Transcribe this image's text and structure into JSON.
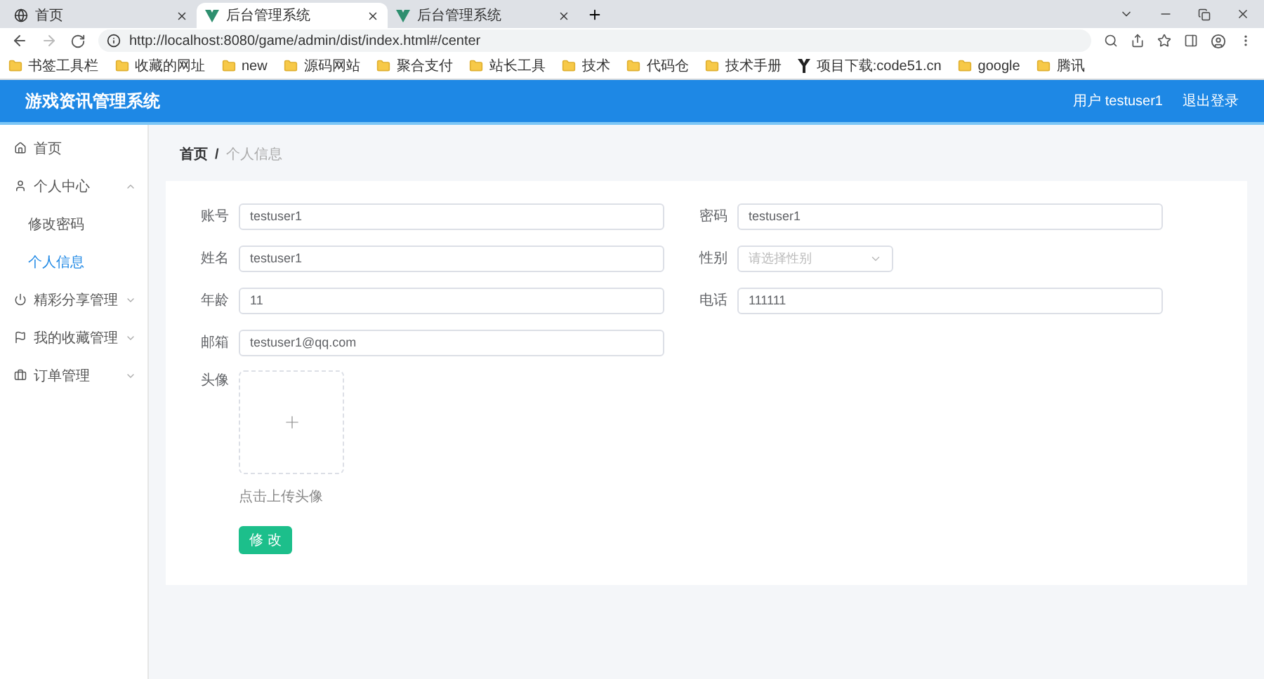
{
  "browser": {
    "tabs": [
      {
        "title": "首页",
        "kind": "globe",
        "selected": false
      },
      {
        "title": "后台管理系统",
        "kind": "vue",
        "selected": true
      },
      {
        "title": "后台管理系统",
        "kind": "vue",
        "selected": false
      }
    ],
    "address": "http://localhost:8080/game/admin/dist/index.html#/center",
    "bookmarks": [
      {
        "label": "书签工具栏",
        "kind": "folder"
      },
      {
        "label": "收藏的网址",
        "kind": "folder"
      },
      {
        "label": "new",
        "kind": "folder"
      },
      {
        "label": "源码网站",
        "kind": "folder"
      },
      {
        "label": "聚合支付",
        "kind": "folder"
      },
      {
        "label": "站长工具",
        "kind": "folder"
      },
      {
        "label": "技术",
        "kind": "folder"
      },
      {
        "label": "代码仓",
        "kind": "folder"
      },
      {
        "label": "技术手册",
        "kind": "folder"
      },
      {
        "label": "项目下载:code51.cn",
        "kind": "logo"
      },
      {
        "label": "google",
        "kind": "folder"
      },
      {
        "label": "腾讯",
        "kind": "folder"
      }
    ]
  },
  "header": {
    "title": "游戏资讯管理系统",
    "user": "用户 testuser1",
    "logout": "退出登录"
  },
  "sidebar": {
    "items": [
      {
        "label": "首页",
        "kind": "home",
        "selected": false
      },
      {
        "label": "个人中心",
        "kind": "user",
        "expanded": true,
        "selected": false,
        "children": [
          {
            "label": "修改密码",
            "selected": false
          },
          {
            "label": "个人信息",
            "selected": true
          }
        ]
      },
      {
        "label": "精彩分享管理",
        "kind": "power",
        "expanded": false,
        "selected": false
      },
      {
        "label": "我的收藏管理",
        "kind": "flag",
        "expanded": false,
        "selected": false
      },
      {
        "label": "订单管理",
        "kind": "bag",
        "expanded": false,
        "selected": false
      }
    ]
  },
  "breadcrumb": [
    {
      "label": "首页",
      "current": false
    },
    {
      "label": "个人信息",
      "current": true
    }
  ],
  "breadcrumb_separator": "/",
  "form": {
    "rows": [
      [
        {
          "label": "账号",
          "kind": "text",
          "value": "testuser1"
        },
        {
          "label": "密码",
          "kind": "text",
          "value": "testuser1"
        }
      ],
      [
        {
          "label": "姓名",
          "kind": "text",
          "value": "testuser1"
        },
        {
          "label": "性别",
          "kind": "select",
          "placeholder": "请选择性别"
        }
      ],
      [
        {
          "label": "年龄",
          "kind": "text",
          "value": "11"
        },
        {
          "label": "电话",
          "kind": "text",
          "value": "111111"
        }
      ],
      [
        {
          "label": "邮箱",
          "kind": "text",
          "value": "testuser1@qq.com"
        }
      ]
    ],
    "avatar": {
      "label": "头像",
      "hint": "点击上传头像"
    },
    "submit": "修 改"
  }
}
